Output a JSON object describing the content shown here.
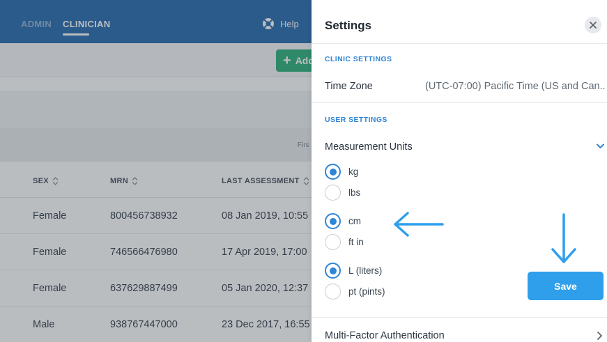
{
  "nav": {
    "admin": "ADMIN",
    "clinician": "CLINICIAN",
    "help": "Help"
  },
  "toolbar": {
    "add_label": "Add"
  },
  "filter_hint": "Firs",
  "table": {
    "headers": [
      "SEX",
      "MRN",
      "LAST ASSESSMENT"
    ],
    "rows": [
      [
        "Female",
        "800456738932",
        "08 Jan 2019, 10:55"
      ],
      [
        "Female",
        "746566476980",
        "17 Apr 2019, 17:00"
      ],
      [
        "Female",
        "637629887499",
        "05 Jan 2020, 12:37"
      ],
      [
        "Male",
        "938767447000",
        "23 Dec 2017, 16:55"
      ]
    ]
  },
  "settings": {
    "title": "Settings",
    "clinic_section": "CLINIC SETTINGS",
    "time_zone_label": "Time Zone",
    "time_zone_value": "(UTC-07:00) Pacific Time (US and Can...",
    "user_section": "USER SETTINGS",
    "measurement_units_label": "Measurement Units",
    "units": [
      {
        "label": "kg",
        "checked": true
      },
      {
        "label": "lbs",
        "checked": false
      },
      {
        "label": "cm",
        "checked": true
      },
      {
        "label": "ft in",
        "checked": false
      },
      {
        "label": "L (liters)",
        "checked": true
      },
      {
        "label": "pt (pints)",
        "checked": false
      }
    ],
    "save_label": "Save",
    "mfa_label": "Multi-Factor Authentication"
  },
  "colors": {
    "topbar": "#2d6fb0",
    "accent": "#2f86d6",
    "save_button": "#2f9fec",
    "add_button": "#33b37f"
  }
}
